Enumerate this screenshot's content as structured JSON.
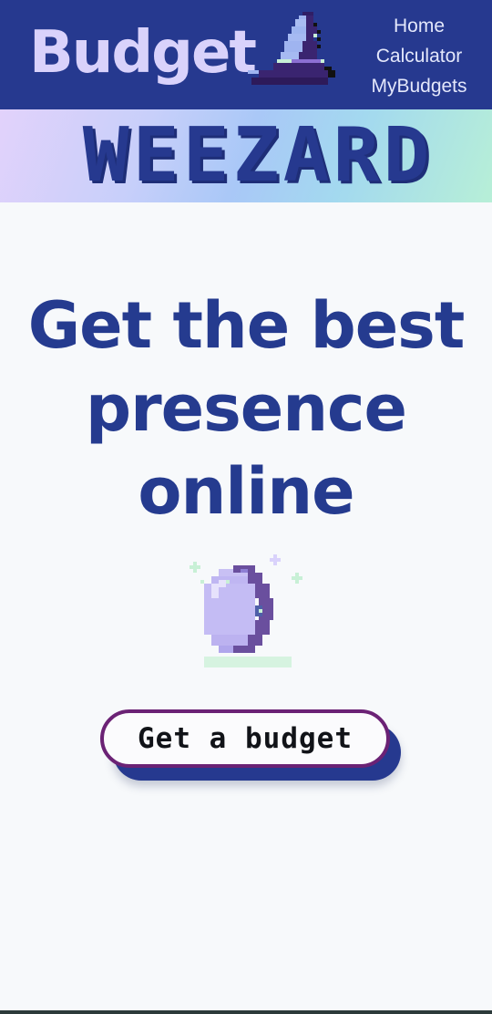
{
  "header": {
    "brand": "Budget",
    "logo_icon": "wizard-hat-icon",
    "nav": [
      {
        "label": "Home"
      },
      {
        "label": "Calculator"
      },
      {
        "label": "MyBudgets"
      }
    ]
  },
  "banner": {
    "title": "WEEZARD"
  },
  "hero": {
    "title": "Get the best presence online",
    "illustration": "crystal-ball-icon",
    "cta_label": "Get a budget"
  },
  "colors": {
    "primary": "#26398f",
    "accent": "#6b2275",
    "background": "#f7f9fb",
    "brand_text": "#d9d2fb"
  }
}
